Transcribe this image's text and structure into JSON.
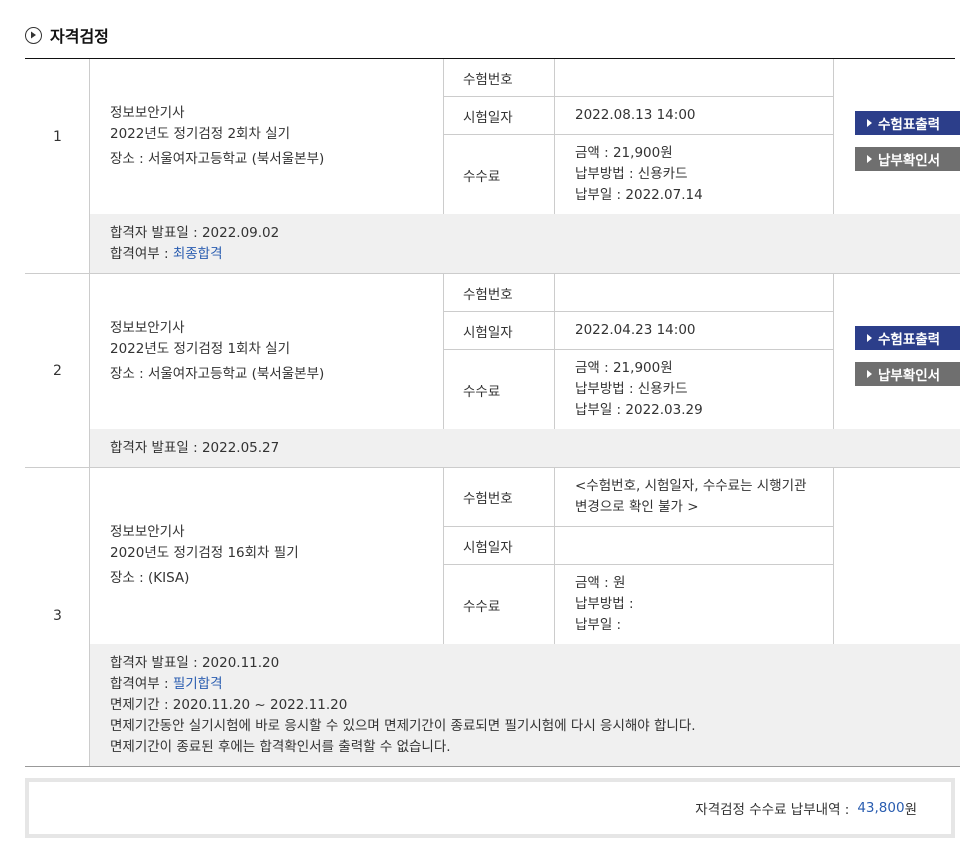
{
  "section": {
    "title": "자격검정",
    "icon": "circle-chevron-right-icon"
  },
  "buttons": {
    "print": "수험표출력",
    "receipt": "납부확인서"
  },
  "labels": {
    "exam_no": "수험번호",
    "exam_date": "시험일자",
    "fee": "수수료"
  },
  "records": [
    {
      "index": "1",
      "name": "정보보안기사",
      "session": "2022년도 정기검정 2회차 실기",
      "place": "장소 : 서울여자고등학교 (북서울본부)",
      "exam_no": "",
      "exam_date": "2022.08.13 14:00",
      "fee_amount": "금액 : 21,900원",
      "fee_method": "납부방법 : 신용카드",
      "fee_date": "납부일 : 2022.07.14",
      "announce": "합격자 발표일 : 2022.09.02",
      "result_label": "합격여부 : ",
      "result_value": "최종합격"
    },
    {
      "index": "2",
      "name": "정보보안기사",
      "session": "2022년도 정기검정 1회차 실기",
      "place": "장소 : 서울여자고등학교 (북서울본부)",
      "exam_no": "",
      "exam_date": "2022.04.23 14:00",
      "fee_amount": "금액 : 21,900원",
      "fee_method": "납부방법 : 신용카드",
      "fee_date": "납부일 : 2022.03.29",
      "announce": "합격자 발표일 : 2022.05.27"
    },
    {
      "index": "3",
      "name": "정보보안기사",
      "session": "2020년도 정기검정 16회차 필기",
      "place": "장소 : (KISA)",
      "exam_no_line1": "<수험번호, 시험일자, 수수료는 시행기관",
      "exam_no_line2": "변경으로 확인 불가 >",
      "exam_date": "",
      "fee_amount": "금액 : 원",
      "fee_method": "납부방법 :",
      "fee_date": "납부일 :",
      "announce": "합격자 발표일 : 2020.11.20",
      "result_label": "합격여부 : ",
      "result_value": "필기합격",
      "exempt_period": "면제기간 : 2020.11.20 ~ 2022.11.20",
      "note1": "면제기간동안 실기시험에 바로 응시할 수 있으며 면제기간이 종료되면 필기시험에 다시 응시해야 합니다.",
      "note2": "면제기간이 종료된 후에는 합격확인서를 출력할 수 없습니다."
    }
  ],
  "total": {
    "label": "자격검정 수수료 납부내역 :",
    "amount": "43,800",
    "unit": "원"
  },
  "colors": {
    "print_button": "#2c3e8a",
    "receipt_button": "#6f6f6f",
    "link_blue": "#2a5db0",
    "summary_bg": "#f0f0f0"
  }
}
